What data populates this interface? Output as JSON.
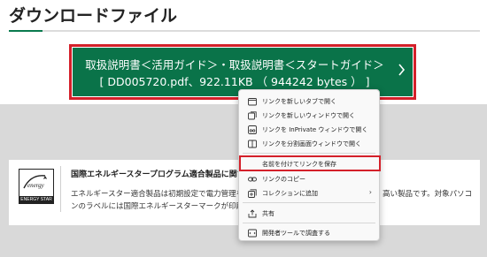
{
  "page": {
    "title": "ダウンロードファイル"
  },
  "download": {
    "line1": "取扱説明書＜活用ガイド＞・取扱説明書＜スタートガイド＞",
    "line2": "[ DD005720.pdf、922.11KB （ 944242 bytes ） ]"
  },
  "certification": {
    "title": "国際エネルギースタープログラム適合製品に関す",
    "text_line1": "エネルギースター適合製品は初期設定で電力管理を",
    "text_line2": "ンのラベルには国際エネルギースターマークが印刷さ",
    "text_tail": "高い製品です。対象パソコ",
    "logo_caption": "ENERGY STAR"
  },
  "context_menu": {
    "items": [
      {
        "label": "リンクを新しいタブで開く",
        "icon": "new-tab-icon"
      },
      {
        "label": "リンクを新しいウィンドウで開く",
        "icon": "new-window-icon"
      },
      {
        "label": "リンクを InPrivate ウィンドウで開く",
        "icon": "inprivate-icon"
      },
      {
        "label": "リンクを分割画面ウィンドウで開く",
        "icon": "split-screen-icon"
      },
      {
        "label": "名前を付けてリンクを保存",
        "icon": ""
      },
      {
        "label": "リンクのコピー",
        "icon": "link-icon"
      },
      {
        "label": "コレクションに追加",
        "icon": "collections-icon",
        "submenu": "›"
      },
      {
        "label": "共有",
        "icon": "share-icon"
      },
      {
        "label": "開発者ツールで調査する",
        "icon": "devtools-icon"
      }
    ]
  },
  "colors": {
    "button_green": "#0a7349",
    "highlight_red": "#d4202a",
    "accent_green": "#0a7a4e"
  }
}
